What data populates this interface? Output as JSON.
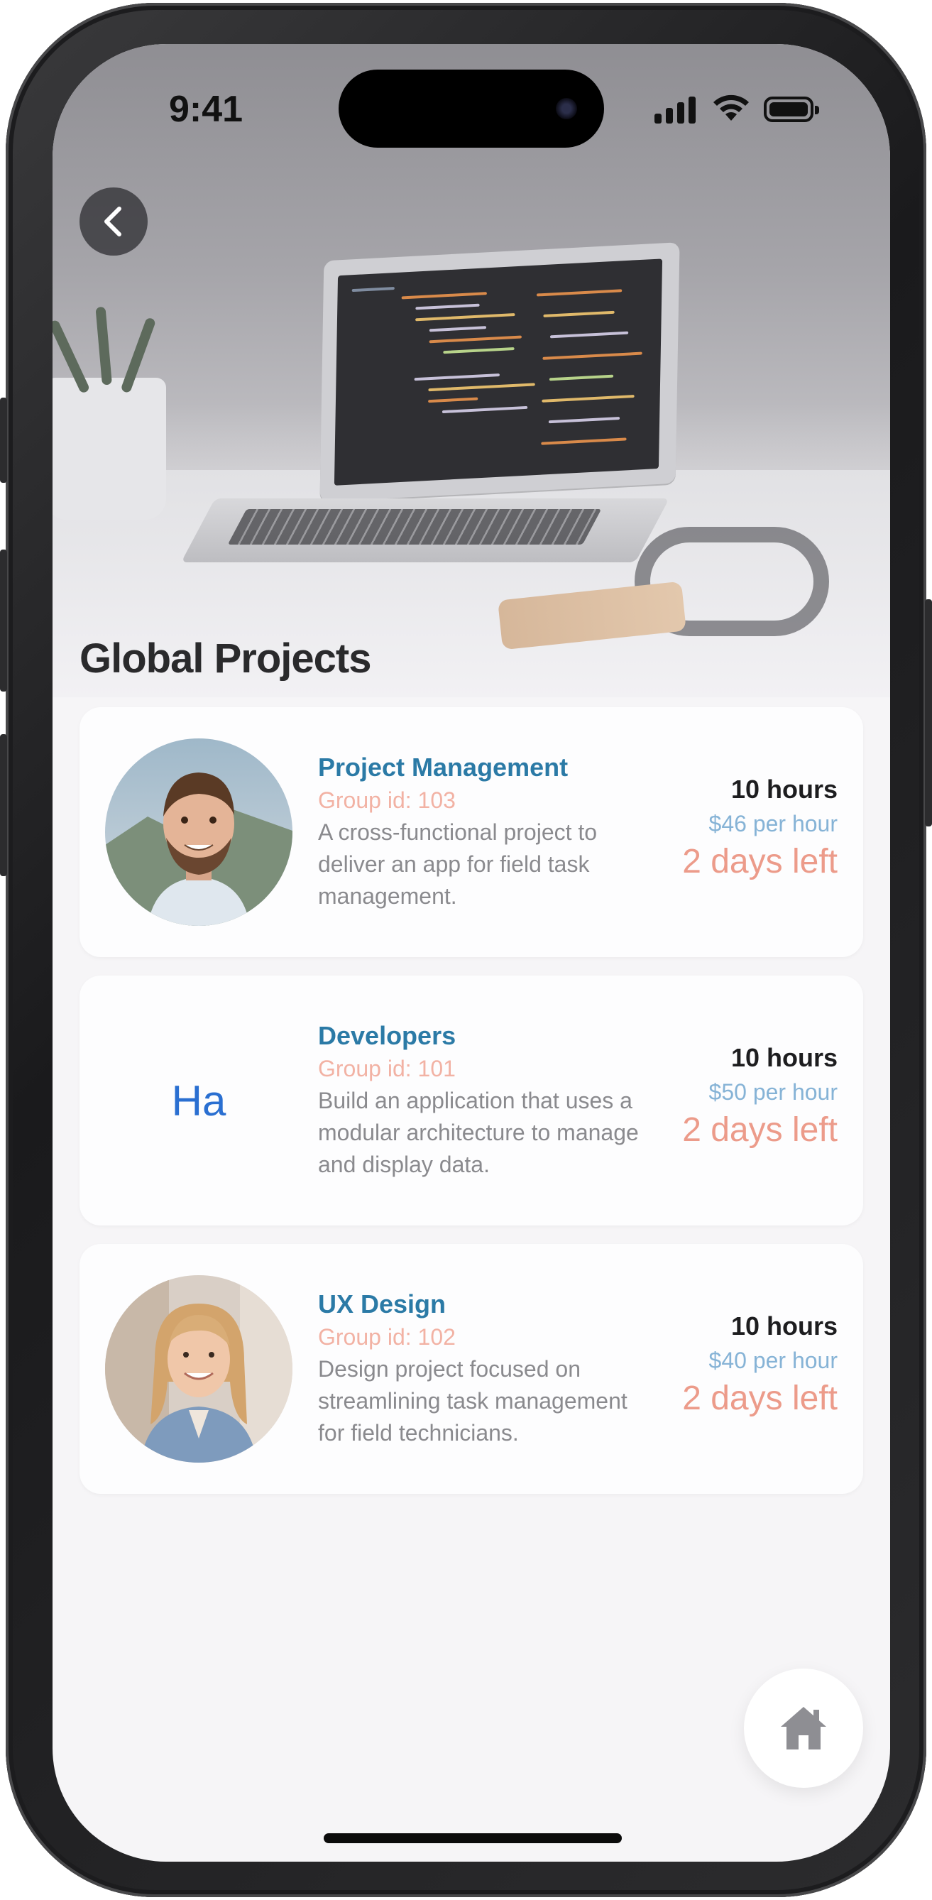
{
  "status_bar": {
    "time": "9:41"
  },
  "header": {
    "title": "Global Projects"
  },
  "projects": [
    {
      "title": "Project Management",
      "group_id": "Group id: 103",
      "description": "A cross-functional project to deliver an app for field task management.",
      "hours": "10 hours",
      "rate": "$46 per hour",
      "days_left": "2 days left",
      "avatar": "photo-man"
    },
    {
      "title": "Developers",
      "group_id": "Group id: 101",
      "description": "Build an application that uses a modular architecture to manage and display data.",
      "hours": "10 hours",
      "rate": "$50 per hour",
      "days_left": "2 days left",
      "avatar_initials": "Ha"
    },
    {
      "title": "UX Design",
      "group_id": "Group id: 102",
      "description": "Design project focused on streamlining task management for field technicians.",
      "hours": "10 hours",
      "rate": "$40 per hour",
      "days_left": "2 days left",
      "avatar": "photo-woman"
    }
  ],
  "icons": {
    "back": "chevron-left-icon",
    "home": "home-icon"
  },
  "colors": {
    "title_blue": "#2b7aa6",
    "group_pink": "#f2b2a4",
    "rate_blue": "#86b3d6",
    "days_coral": "#ec9b8a",
    "initials_blue": "#2a6fd1"
  }
}
